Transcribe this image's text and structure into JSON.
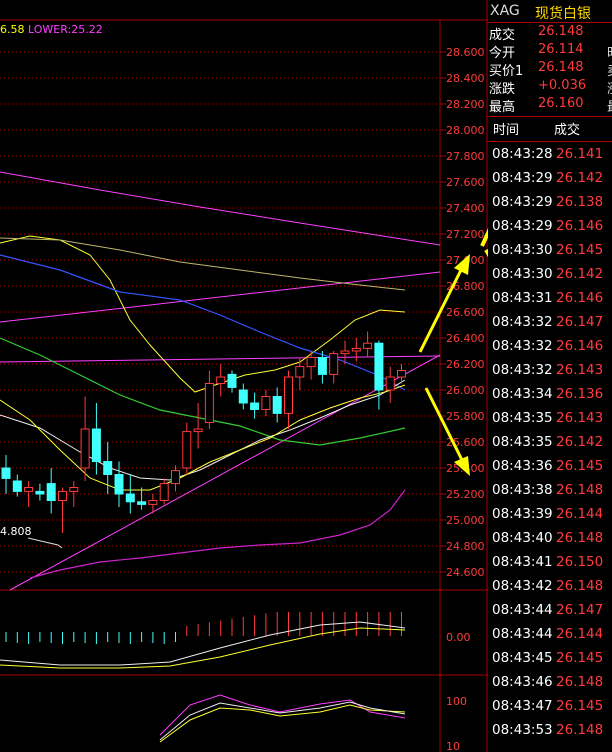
{
  "indicator": {
    "mid_value": "6.58",
    "lower_label": "LOWER:25.22",
    "min_marker": "4.808"
  },
  "y_axis": {
    "labels": [
      "28.600",
      "28.400",
      "28.200",
      "28.000",
      "27.800",
      "27.600",
      "27.400",
      "27.200",
      "27.000",
      "26.800",
      "26.600",
      "26.400",
      "26.200",
      "26.000",
      "25.800",
      "25.600",
      "25.400",
      "25.200",
      "25.000",
      "24.800",
      "24.600"
    ]
  },
  "macd_axis": {
    "label": "0.00"
  },
  "kdj_axis": {
    "top": "100",
    "bottom": "10"
  },
  "quote": {
    "symbol": "XAG",
    "name": "现货白银",
    "rows": [
      {
        "label": "成交",
        "value": "26.148"
      },
      {
        "label": "今开",
        "value": "26.114"
      },
      {
        "label": "买价1",
        "value": "26.148"
      },
      {
        "label": "涨跌",
        "value": "+0.036"
      },
      {
        "label": "最高",
        "value": "26.160"
      }
    ],
    "edge_chars": [
      "",
      "时",
      "卖",
      "涨",
      "最"
    ]
  },
  "ticks": {
    "header_time": "时间",
    "header_price": "成交",
    "rows": [
      {
        "time": "08:43:28",
        "price": "26.141"
      },
      {
        "time": "08:43:29",
        "price": "26.142"
      },
      {
        "time": "08:43:29",
        "price": "26.138"
      },
      {
        "time": "08:43:29",
        "price": "26.146"
      },
      {
        "time": "08:43:30",
        "price": "26.145"
      },
      {
        "time": "08:43:30",
        "price": "26.142"
      },
      {
        "time": "08:43:31",
        "price": "26.146"
      },
      {
        "time": "08:43:32",
        "price": "26.147"
      },
      {
        "time": "08:43:32",
        "price": "26.146"
      },
      {
        "time": "08:43:32",
        "price": "26.143"
      },
      {
        "time": "08:43:34",
        "price": "26.136"
      },
      {
        "time": "08:43:35",
        "price": "26.143"
      },
      {
        "time": "08:43:35",
        "price": "26.142"
      },
      {
        "time": "08:43:36",
        "price": "26.145"
      },
      {
        "time": "08:43:38",
        "price": "26.148"
      },
      {
        "time": "08:43:39",
        "price": "26.144"
      },
      {
        "time": "08:43:40",
        "price": "26.148"
      },
      {
        "time": "08:43:41",
        "price": "26.150"
      },
      {
        "time": "08:43:42",
        "price": "26.148"
      },
      {
        "time": "08:43:44",
        "price": "26.147"
      },
      {
        "time": "08:43:44",
        "price": "26.144"
      },
      {
        "time": "08:43:45",
        "price": "26.145"
      },
      {
        "time": "08:43:46",
        "price": "26.148"
      },
      {
        "time": "08:43:47",
        "price": "26.145"
      },
      {
        "time": "08:43:53",
        "price": "26.148"
      }
    ]
  },
  "colors": {
    "up": "#ff3b3b",
    "down": "#40ffff",
    "arrow": "#ffff00",
    "grid": "#aa0000"
  },
  "chart_data": {
    "type": "candlestick",
    "unit": "price",
    "ylim": [
      24.5,
      28.7
    ],
    "candles": [
      {
        "o": 25.4,
        "h": 25.5,
        "l": 25.2,
        "c": 25.32
      },
      {
        "o": 25.3,
        "h": 25.35,
        "l": 25.18,
        "c": 25.22
      },
      {
        "o": 25.22,
        "h": 25.3,
        "l": 25.1,
        "c": 25.25
      },
      {
        "o": 25.22,
        "h": 25.28,
        "l": 25.15,
        "c": 25.2
      },
      {
        "o": 25.28,
        "h": 25.4,
        "l": 25.05,
        "c": 25.15
      },
      {
        "o": 25.15,
        "h": 25.25,
        "l": 24.9,
        "c": 25.22
      },
      {
        "o": 25.22,
        "h": 25.3,
        "l": 25.1,
        "c": 25.25
      },
      {
        "o": 25.4,
        "h": 25.95,
        "l": 25.3,
        "c": 25.7
      },
      {
        "o": 25.7,
        "h": 25.9,
        "l": 25.35,
        "c": 25.45
      },
      {
        "o": 25.45,
        "h": 25.6,
        "l": 25.2,
        "c": 25.35
      },
      {
        "o": 25.35,
        "h": 25.45,
        "l": 25.1,
        "c": 25.2
      },
      {
        "o": 25.2,
        "h": 25.35,
        "l": 25.05,
        "c": 25.14
      },
      {
        "o": 25.14,
        "h": 25.25,
        "l": 25.08,
        "c": 25.12
      },
      {
        "o": 25.12,
        "h": 25.2,
        "l": 25.05,
        "c": 25.15
      },
      {
        "o": 25.15,
        "h": 25.32,
        "l": 25.12,
        "c": 25.28
      },
      {
        "o": 25.28,
        "h": 25.42,
        "l": 25.22,
        "c": 25.38
      },
      {
        "o": 25.4,
        "h": 25.75,
        "l": 25.35,
        "c": 25.68
      },
      {
        "o": 25.68,
        "h": 25.9,
        "l": 25.55,
        "c": 25.7
      },
      {
        "o": 25.75,
        "h": 26.15,
        "l": 25.7,
        "c": 26.05
      },
      {
        "o": 26.05,
        "h": 26.2,
        "l": 25.95,
        "c": 26.1
      },
      {
        "o": 26.12,
        "h": 26.15,
        "l": 25.98,
        "c": 26.02
      },
      {
        "o": 26.0,
        "h": 26.05,
        "l": 25.85,
        "c": 25.9
      },
      {
        "o": 25.9,
        "h": 25.98,
        "l": 25.78,
        "c": 25.85
      },
      {
        "o": 25.85,
        "h": 26.0,
        "l": 25.8,
        "c": 25.95
      },
      {
        "o": 25.95,
        "h": 26.02,
        "l": 25.75,
        "c": 25.82
      },
      {
        "o": 25.82,
        "h": 26.15,
        "l": 25.7,
        "c": 26.1
      },
      {
        "o": 26.1,
        "h": 26.25,
        "l": 26.0,
        "c": 26.18
      },
      {
        "o": 26.18,
        "h": 26.3,
        "l": 26.08,
        "c": 26.25
      },
      {
        "o": 26.25,
        "h": 26.3,
        "l": 26.05,
        "c": 26.12
      },
      {
        "o": 26.12,
        "h": 26.3,
        "l": 26.05,
        "c": 26.28
      },
      {
        "o": 26.28,
        "h": 26.38,
        "l": 26.2,
        "c": 26.3
      },
      {
        "o": 26.3,
        "h": 26.4,
        "l": 26.22,
        "c": 26.32
      },
      {
        "o": 26.32,
        "h": 26.45,
        "l": 26.25,
        "c": 26.36
      },
      {
        "o": 26.36,
        "h": 26.38,
        "l": 25.85,
        "c": 26.0
      },
      {
        "o": 26.0,
        "h": 26.18,
        "l": 25.9,
        "c": 26.1
      },
      {
        "o": 26.1,
        "h": 26.2,
        "l": 26.05,
        "c": 26.15
      }
    ]
  }
}
